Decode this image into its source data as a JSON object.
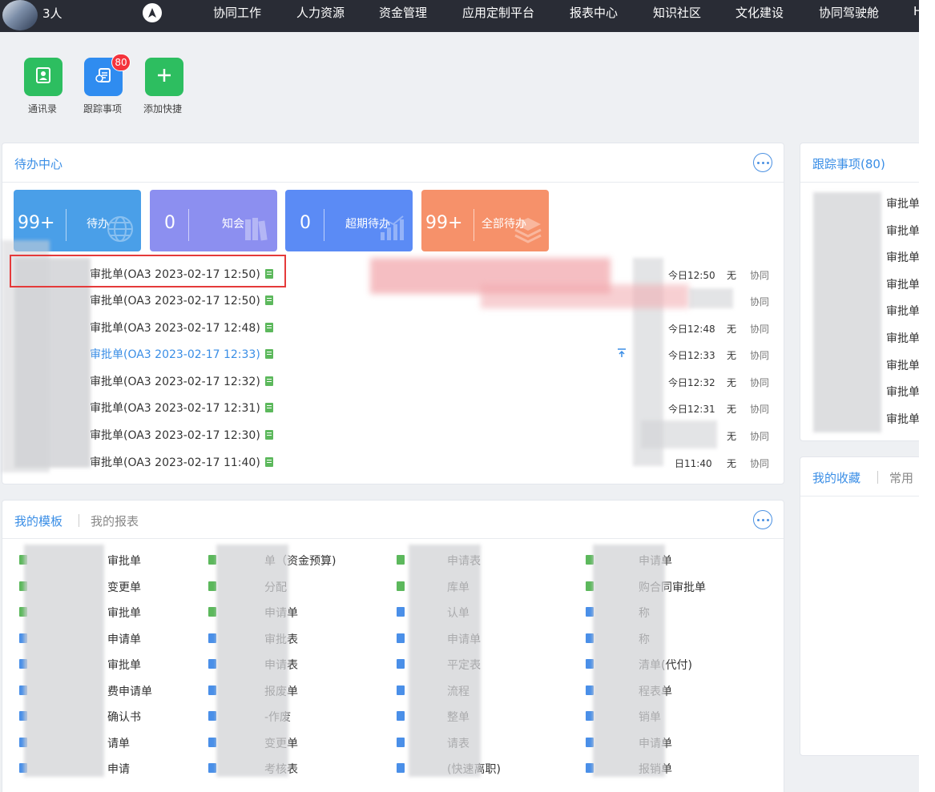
{
  "topbar": {
    "user_count": "3人",
    "nav": [
      "协同工作",
      "人力资源",
      "资金管理",
      "应用定制平台",
      "报表中心",
      "知识社区",
      "文化建设",
      "协同驾驶舱",
      "H"
    ]
  },
  "quick_actions": [
    {
      "label": "通讯录",
      "icon": "contacts-icon",
      "color": "#2dbe60"
    },
    {
      "label": "跟踪事项",
      "icon": "track-list-icon",
      "color": "#2f8cf0",
      "badge": "80"
    },
    {
      "label": "添加快捷",
      "icon": "plus-icon",
      "color": "#2dbe60"
    }
  ],
  "todo": {
    "title": "待办中心",
    "cards": [
      {
        "count": "99+",
        "label": "待办",
        "color": "#4a9fe8",
        "icon": "globe-icon"
      },
      {
        "count": "0",
        "label": "知会",
        "color": "#8c8ff0",
        "icon": "books-icon"
      },
      {
        "count": "0",
        "label": "超期待办",
        "color": "#5b8bf5",
        "icon": "chart-up-icon"
      },
      {
        "count": "99+",
        "label": "全部待办",
        "color": "#f6916a",
        "icon": "stack-icon"
      }
    ],
    "rows": [
      {
        "title": "审批单(OA3 2023-02-17 12:50)",
        "time": "今日12:50",
        "importance": "无",
        "source": "协同"
      },
      {
        "title": "审批单(OA3 2023-02-17 12:50)",
        "time": "",
        "importance": "",
        "source": "协同"
      },
      {
        "title": "审批单(OA3 2023-02-17 12:48)",
        "time": "今日12:48",
        "importance": "无",
        "source": "协同"
      },
      {
        "title": "审批单(OA3 2023-02-17 12:33)",
        "time": "今日12:33",
        "importance": "无",
        "source": "协同"
      },
      {
        "title": "审批单(OA3 2023-02-17 12:32)",
        "time": "今日12:32",
        "importance": "无",
        "source": "协同"
      },
      {
        "title": "审批单(OA3 2023-02-17 12:31)",
        "time": "今日12:31",
        "importance": "无",
        "source": "协同"
      },
      {
        "title": "审批单(OA3 2023-02-17 12:30)",
        "time": "",
        "importance": "无",
        "source": "协同"
      },
      {
        "title": "审批单(OA3 2023-02-17 11:40)",
        "time": "日11:40",
        "importance": "无",
        "source": "协同"
      }
    ]
  },
  "templates": {
    "tab_active": "我的模板",
    "tab_inactive": "我的报表",
    "columns": [
      [
        {
          "label": "审批单",
          "icon": "g"
        },
        {
          "label": "变更单",
          "icon": "g"
        },
        {
          "label": "审批单",
          "icon": "g"
        },
        {
          "label": "申请单",
          "icon": "b"
        },
        {
          "label": "审批单",
          "icon": "b"
        },
        {
          "label": "费申请单",
          "icon": "b"
        },
        {
          "label": "确认书",
          "icon": "b"
        },
        {
          "label": "请单",
          "icon": "b"
        },
        {
          "label": "申请",
          "icon": "b"
        }
      ],
      [
        {
          "label": "单（资金预算)",
          "icon": "g"
        },
        {
          "label": "分配",
          "icon": "g"
        },
        {
          "label": "申请单",
          "icon": "g"
        },
        {
          "label": "审批表",
          "icon": "b"
        },
        {
          "label": "申请表",
          "icon": "b"
        },
        {
          "label": "报废单",
          "icon": "b"
        },
        {
          "label": "-作废",
          "icon": "b"
        },
        {
          "label": "变更单",
          "icon": "b"
        },
        {
          "label": "考核表",
          "icon": "b"
        }
      ],
      [
        {
          "label": "申请表",
          "icon": "g"
        },
        {
          "label": "库单",
          "icon": "g"
        },
        {
          "label": "认单",
          "icon": "b"
        },
        {
          "label": "申请单",
          "icon": "b"
        },
        {
          "label": "平定表",
          "icon": "b"
        },
        {
          "label": "流程",
          "icon": "b"
        },
        {
          "label": "整单",
          "icon": "b"
        },
        {
          "label": "请表",
          "icon": "b"
        },
        {
          "label": "(快速离职)",
          "icon": "b"
        }
      ],
      [
        {
          "label": "申请单",
          "icon": "g"
        },
        {
          "label": "购合同审批单",
          "icon": "g"
        },
        {
          "label": "称",
          "icon": "b"
        },
        {
          "label": "称",
          "icon": "b"
        },
        {
          "label": "清单(代付)",
          "icon": "b"
        },
        {
          "label": "程表单",
          "icon": "b"
        },
        {
          "label": "销单",
          "icon": "b"
        },
        {
          "label": "申请单",
          "icon": "b"
        },
        {
          "label": "报销单",
          "icon": "b"
        }
      ]
    ]
  },
  "tracking": {
    "title": "跟踪事项(80)",
    "items": [
      "审批单",
      "审批单",
      "审批单",
      "审批单",
      "审批单",
      "审批单",
      "审批单",
      "审批单",
      "审批单"
    ]
  },
  "favorites": {
    "tab_active": "我的收藏",
    "tab_inactive": "常用"
  }
}
